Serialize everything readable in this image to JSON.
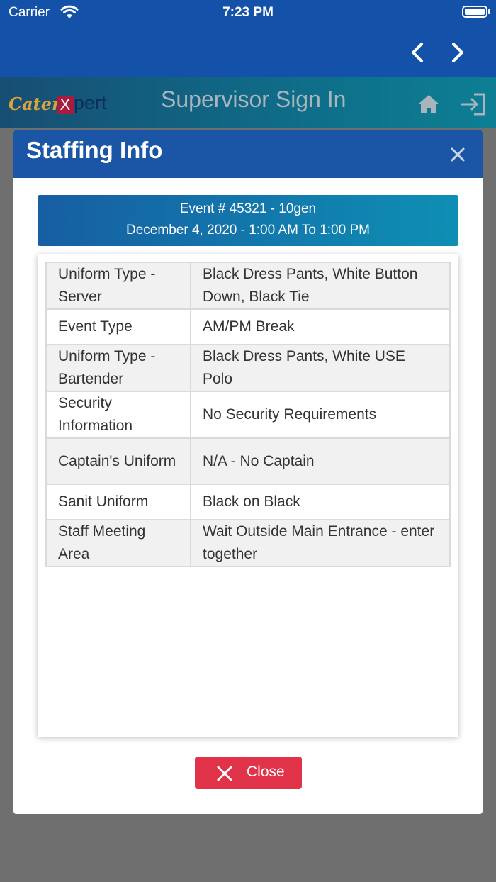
{
  "status_bar": {
    "carrier": "Carrier",
    "time": "7:23 PM"
  },
  "nav": {
    "back_icon": "chevron-left-icon",
    "forward_icon": "chevron-right-icon"
  },
  "header": {
    "logo_cater": "Cater",
    "logo_x": "X",
    "logo_pert": "pert",
    "title": "Supervisor Sign In",
    "home_icon": "home-icon",
    "signin_icon": "sign-in-icon"
  },
  "modal": {
    "title": "Staffing Info",
    "event_line1": "Event # 45321  -  10gen",
    "event_line2": "December 4, 2020   -  1:00 AM To 1:00 PM",
    "rows": [
      {
        "label": "Uniform Type - Server",
        "value": "Black Dress Pants, White Button Down, Black Tie"
      },
      {
        "label": "Event Type",
        "value": "AM/PM Break"
      },
      {
        "label": "Uniform Type - Bartender",
        "value": "Black Dress Pants, White USE Polo"
      },
      {
        "label": "Security Information",
        "value": "No Security Requirements"
      },
      {
        "label": "Captain's Uniform",
        "value": "N/A - No Captain"
      },
      {
        "label": "Sanit Uniform",
        "value": "Black on Black"
      },
      {
        "label": "Staff Meeting Area",
        "value": "Wait Outside Main Entrance - enter together"
      }
    ],
    "close_label": "Close",
    "colors": {
      "header": "#1b56a6",
      "close_button": "#e0334a",
      "banner": "#0e8fb4"
    }
  }
}
